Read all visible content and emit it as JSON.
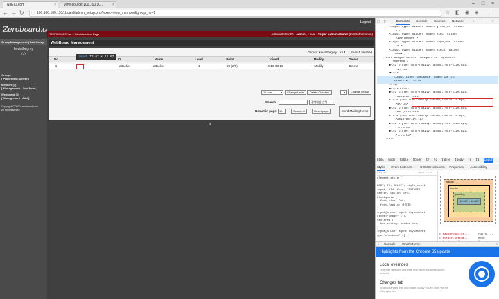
{
  "browser": {
    "tabs": [
      {
        "title": "NJEID.com"
      },
      {
        "title": "view-source:100.100.10..."
      }
    ],
    "url": "100.100.100.110/zboard/admin_setup.php?exec=view_member&group_no=1"
  },
  "app": {
    "logo": "Zeroboard.com",
    "logout": "Logout",
    "version_text": "ZEROBOARD Ver.4 Administration Page",
    "admin_label": "Administrator ID :",
    "admin_id": "admin",
    "level_label": ", Level :",
    "level_value": "Super Administrator",
    "edit_info": "(Edit Information)"
  },
  "sidebar": {
    "header": "Group Management | Add Group",
    "group_name": "kevinthegrey",
    "group_count": "(1)",
    "sections": [
      {
        "line1": "Group :",
        "line2": "[ Properties | Delete ]"
      },
      {
        "line1": "Member (1)",
        "line2": "[ Management | Join Form ]"
      },
      {
        "line1": "Webboard (1)",
        "line2": "[ Management | Add ]"
      }
    ],
    "copyright_1": "Copyright(C)2000, zeroboard.com",
    "copyright_2": "All right reserved."
  },
  "main": {
    "title": "WebBoard Management",
    "group_info": "Group : kevinthegrey , All",
    "group_info_bold": "1",
    "group_info_search": ", 1 Search finished",
    "columns": [
      "No",
      "Select",
      "ID",
      "Name",
      "Level",
      "Point",
      "Joined",
      "Modify",
      "Delete"
    ],
    "rows": [
      {
        "no": "1",
        "id": "attacker",
        "name": "attacker",
        "level": "4",
        "point": "20 (2/0)",
        "joined": "2018-03-19",
        "modify": "Modify",
        "delete": "Delete"
      }
    ],
    "tooltip_tag": "input",
    "tooltip_size": "12.67 × 12.67",
    "level_select": "1 Level",
    "change_level": "Change Level",
    "delete_checked": "Delete Checked",
    "change_group": "Change Group",
    "search_label": "Search",
    "search_select": "검색대상 선택",
    "result_label": "Result in page",
    "result_value": "10",
    "search_btn": "Search it!",
    "reset_btn": "Reset page",
    "mailing_btn": "Send Mailing News",
    "page_number": "1"
  },
  "devtools": {
    "tabs": [
      "Elements",
      "Console",
      "Sources",
      "Network"
    ],
    "code_lines": [
      "<input type=\"hidden\" name=\"group_no\" value=",
      "\"1\">",
      "<input type=\"hidden\" name=\"exec\" value=",
      "\"view_member\">",
      "<input type=\"hidden\" name=\"page_num\" value=",
      "\"10\">",
      "<input type=\"hidden\" name=\"exec2\" value=",
      "\"modify\">",
      "▼<tr align=\"center\" height=\"23\" bgcolor=",
      "\"#e0e0e0\">",
      "▶<td style=\"font-family:Tahoma;font-size:8pt;",
      "\">1</td>",
      "▼<td>",
      "<input type=\"checkbox\" name=\"cart[]\"",
      "value=\"2\"> == $0",
      "</td>",
      "▶<td>…</td>",
      "▶<td style=\"font-family:Tahoma;font-size:8pt;",
      "\">attacker</td>",
      "<td style=\"font-family:Tahoma;font-size:8pt;",
      "\">4</td>",
      "▶<td style=\"font-family:Tahoma;font-size:8pt;",
      "\">20 (2/0)</td>",
      "<td style=\"font-family:Tahoma;font-size:8pt;",
      "\">2018-03-19</td>",
      "▶<td style=\"font-family:Tahoma;font-size:8pt;",
      "\">...</td>",
      "▶<td style=\"font-family:Tahoma;font-size:8pt;",
      "\">...</td>",
      "</tr>"
    ],
    "breadcrumb": [
      "html",
      "body",
      "table",
      "tbody",
      "tr",
      "td",
      "table",
      "tbody",
      "tr",
      "td",
      "input"
    ],
    "style_tabs": [
      "Styles",
      "Event Listeners",
      "DOM Breakpoints",
      "Properties",
      "Accessibility"
    ],
    "filter_placeholder": "Filter",
    "filter_opts": ":hov .cls +",
    "styles_lines": [
      "element.style {",
      "}",
      "BODY, TD, SELECT, stylo_css:1",
      "input, DIV, form, TEXTAREA,",
      "center, option, pre,",
      "blockquote {",
      "  font-size: 9pt;",
      "  font-family: 굴림체;",
      "}",
      "input[a user agent stylesheet",
      "rtype=\"image\" i]),",
      "textarea {",
      "  box-sizing: border-box;",
      "}",
      "input[a user agent stylesheet",
      "ype=\"checkbox\" i] {"
    ],
    "box": {
      "margin": "margin",
      "border": "border",
      "padding": "padding",
      "content": "12.667 × 12.667"
    },
    "computed": [
      {
        "prop": "background-co...",
        "val": "rgb(0,..."
      },
      {
        "prop": "border-bottom...",
        "val": "none"
      },
      {
        "prop": "border-bottom...",
        "val": "0px"
      },
      {
        "prop": "border-collap...",
        "val": "separate"
      }
    ],
    "drawer_tabs": [
      "Console",
      "What's New ×"
    ],
    "banner": "Highlights from the Chrome 65 update",
    "features": [
      {
        "title": "Local overrides",
        "desc": "Override network requests and serve local resources instead."
      },
      {
        "title": "Changes tab",
        "desc": "Track changes that you make locally in DevTools via the Changes tab."
      }
    ]
  }
}
